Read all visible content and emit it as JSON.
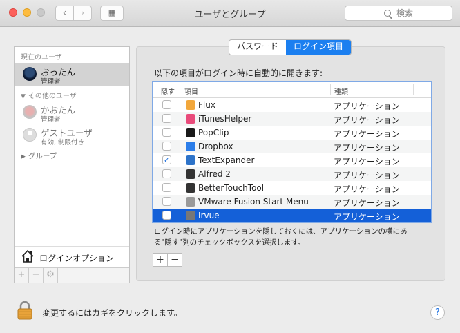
{
  "window": {
    "title": "ユーザとグループ"
  },
  "toolbar": {
    "back": "‹",
    "forward": "›",
    "grid": "▦",
    "search_placeholder": "検索"
  },
  "sidebar": {
    "current_header": "現在のユーザ",
    "current_user": {
      "name": "おったん",
      "role": "管理者"
    },
    "other_header": "その他のユーザ",
    "other_users": [
      {
        "name": "かおたん",
        "role": "管理者"
      },
      {
        "name": "ゲストユーザ",
        "role": "有効, 制限付き"
      }
    ],
    "group_label": "グループ",
    "login_options": "ログインオプション",
    "tools": [
      "+",
      "−",
      "⚙"
    ]
  },
  "tabs": [
    {
      "label": "パスワード",
      "active": false
    },
    {
      "label": "ログイン項目",
      "active": true
    }
  ],
  "main": {
    "description": "以下の項目がログイン時に自動的に開きます:",
    "columns": {
      "hide": "隠す",
      "item": "項目",
      "kind": "種類"
    },
    "items": [
      {
        "name": "Flux",
        "kind": "アプリケーション",
        "hidden": false,
        "icon": "flux-icon",
        "color": "#f2a73b"
      },
      {
        "name": "iTunesHelper",
        "kind": "アプリケーション",
        "hidden": false,
        "icon": "itunes-icon",
        "color": "#e94a7a"
      },
      {
        "name": "PopClip",
        "kind": "アプリケーション",
        "hidden": false,
        "icon": "popclip-icon",
        "color": "#1a1a1a"
      },
      {
        "name": "Dropbox",
        "kind": "アプリケーション",
        "hidden": false,
        "icon": "dropbox-icon",
        "color": "#2b7de9"
      },
      {
        "name": "TextExpander",
        "kind": "アプリケーション",
        "hidden": true,
        "icon": "textexpander-icon",
        "color": "#2d73c9"
      },
      {
        "name": "Alfred 2",
        "kind": "アプリケーション",
        "hidden": false,
        "icon": "alfred-icon",
        "color": "#333333"
      },
      {
        "name": "BetterTouchTool",
        "kind": "アプリケーション",
        "hidden": false,
        "icon": "bettertouchtool-icon",
        "color": "#333333"
      },
      {
        "name": "VMware Fusion Start Menu",
        "kind": "アプリケーション",
        "hidden": false,
        "icon": "vmware-icon",
        "color": "#9a9a9a"
      },
      {
        "name": "Irvue",
        "kind": "アプリケーション",
        "hidden": false,
        "icon": "irvue-icon",
        "color": "#777777",
        "selected": true
      }
    ],
    "hint": "ログイン時にアプリケーションを隠しておくには、アプリケーションの横にある\"隠す\"列のチェックボックスを選択します。",
    "add": "+",
    "remove": "−"
  },
  "footer": {
    "lock_text": "変更するにはカギをクリックします。",
    "help": "?"
  }
}
